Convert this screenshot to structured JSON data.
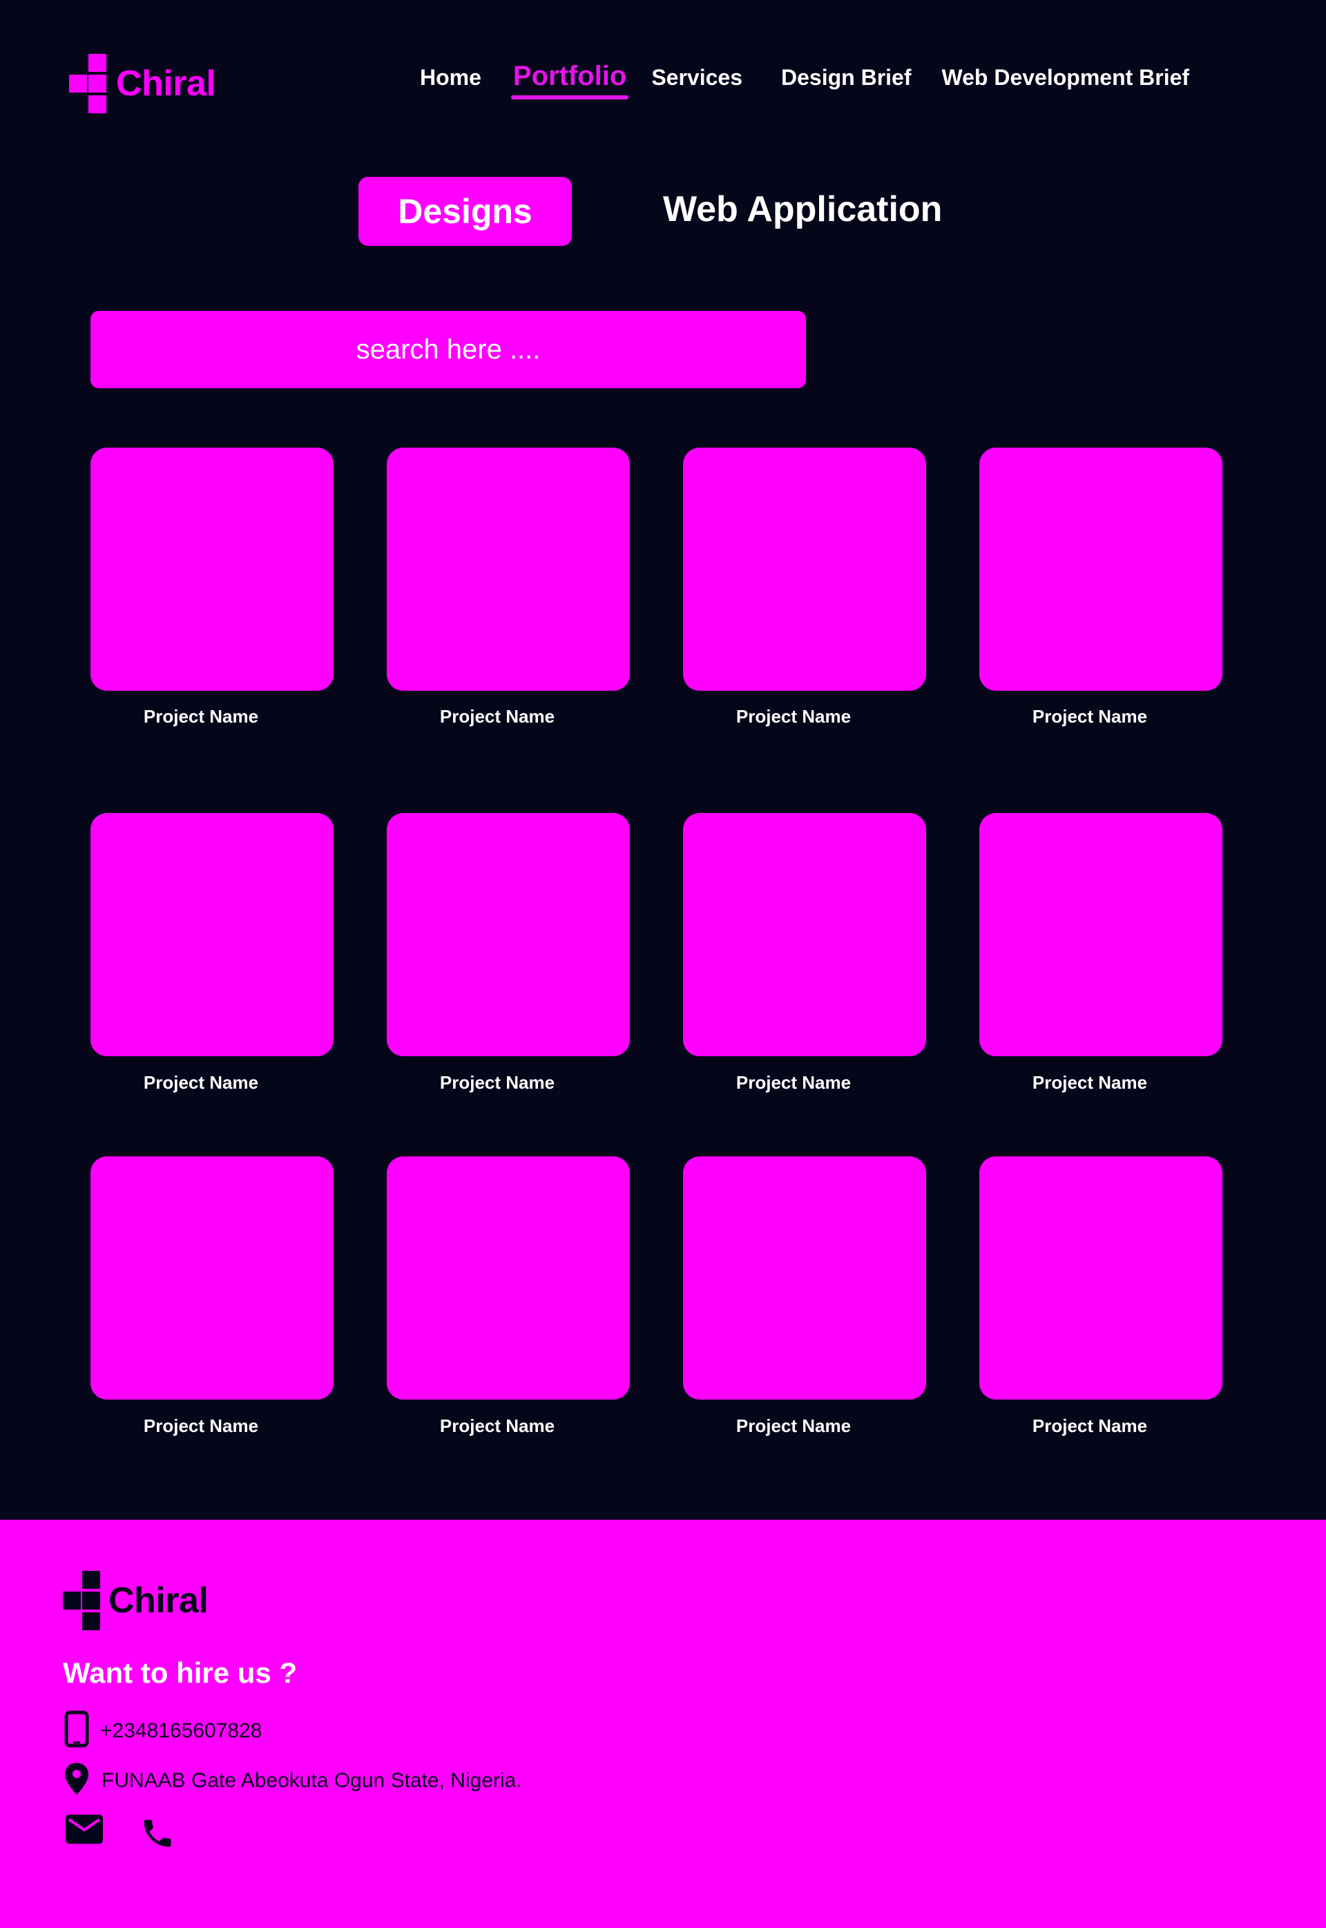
{
  "brand": {
    "name": "Chiral",
    "accent": "#ff00ff",
    "background": "#05061a"
  },
  "nav": {
    "items": [
      {
        "label": "Home"
      },
      {
        "label": "Portfolio",
        "active": true
      },
      {
        "label": "Services"
      },
      {
        "label": "Design Brief"
      },
      {
        "label": "Web Development Brief"
      }
    ]
  },
  "tabs": [
    {
      "label": "Designs",
      "active": true
    },
    {
      "label": "Web Application",
      "active": false
    }
  ],
  "search": {
    "placeholder": "search here ...."
  },
  "projects": [
    {
      "name": "Project Name"
    },
    {
      "name": "Project Name"
    },
    {
      "name": "Project Name"
    },
    {
      "name": "Project Name"
    },
    {
      "name": "Project Name"
    },
    {
      "name": "Project Name"
    },
    {
      "name": "Project Name"
    },
    {
      "name": "Project Name"
    },
    {
      "name": "Project Name"
    },
    {
      "name": "Project Name"
    },
    {
      "name": "Project Name"
    },
    {
      "name": "Project Name"
    }
  ],
  "footer": {
    "brand": "Chiral",
    "hire_heading": "Want to hire us ?",
    "phone": "+2348165607828",
    "address": "FUNAAB Gate Abeokuta Ogun State, Nigeria.",
    "icons": [
      "mobile-phone-icon",
      "location-pin-icon",
      "mail-icon",
      "phone-icon"
    ]
  }
}
